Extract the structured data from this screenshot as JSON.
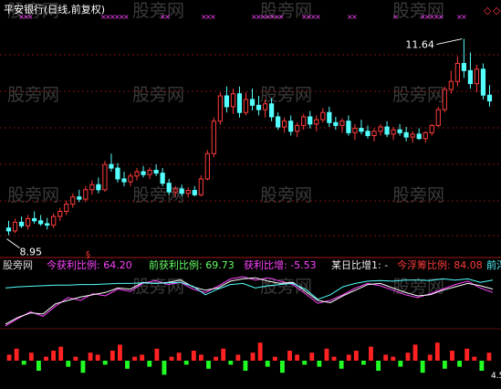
{
  "chart_data": [
    {
      "type": "candlestick",
      "title": "平安银行(日线,前复权)",
      "annotations": {
        "high_label": "11.64",
        "low_label": "8.95"
      },
      "colors": {
        "up": "#ff3b3b",
        "down": "#54ffff",
        "title": "#ffffff",
        "marker": "#ff44ff",
        "grid": "#7a1010"
      },
      "ylim": [
        8.7,
        11.9
      ],
      "candles": [
        [
          9.02,
          9.12,
          8.92,
          8.98
        ],
        [
          8.98,
          9.15,
          8.95,
          9.1
        ],
        [
          9.1,
          9.18,
          9.02,
          9.05
        ],
        [
          9.05,
          9.2,
          9.0,
          9.15
        ],
        [
          9.15,
          9.25,
          9.08,
          9.12
        ],
        [
          9.12,
          9.2,
          9.05,
          9.08
        ],
        [
          9.08,
          9.16,
          9.0,
          9.06
        ],
        [
          9.06,
          9.22,
          9.02,
          9.18
        ],
        [
          9.18,
          9.3,
          9.12,
          9.25
        ],
        [
          9.25,
          9.4,
          9.2,
          9.35
        ],
        [
          9.35,
          9.5,
          9.3,
          9.45
        ],
        [
          9.45,
          9.55,
          9.38,
          9.42
        ],
        [
          9.42,
          9.6,
          9.38,
          9.55
        ],
        [
          9.55,
          9.68,
          9.48,
          9.62
        ],
        [
          9.62,
          9.72,
          9.5,
          9.55
        ],
        [
          9.55,
          9.95,
          9.52,
          9.9
        ],
        [
          9.9,
          10.05,
          9.8,
          9.85
        ],
        [
          9.85,
          9.92,
          9.65,
          9.7
        ],
        [
          9.7,
          9.8,
          9.6,
          9.66
        ],
        [
          9.66,
          9.78,
          9.6,
          9.74
        ],
        [
          9.74,
          9.85,
          9.68,
          9.8
        ],
        [
          9.8,
          9.88,
          9.72,
          9.76
        ],
        [
          9.76,
          9.86,
          9.7,
          9.82
        ],
        [
          9.82,
          9.9,
          9.74,
          9.78
        ],
        [
          9.78,
          9.85,
          9.6,
          9.64
        ],
        [
          9.64,
          9.7,
          9.48,
          9.52
        ],
        [
          9.52,
          9.6,
          9.45,
          9.56
        ],
        [
          9.56,
          9.62,
          9.46,
          9.5
        ],
        [
          9.5,
          9.58,
          9.44,
          9.54
        ],
        [
          9.54,
          9.6,
          9.46,
          9.48
        ],
        [
          9.48,
          9.75,
          9.46,
          9.7
        ],
        [
          9.7,
          10.1,
          9.68,
          10.05
        ],
        [
          10.05,
          10.55,
          10.0,
          10.5
        ],
        [
          10.5,
          10.9,
          10.45,
          10.85
        ],
        [
          10.85,
          10.98,
          10.62,
          10.7
        ],
        [
          10.7,
          10.95,
          10.6,
          10.88
        ],
        [
          10.88,
          10.98,
          10.55,
          10.62
        ],
        [
          10.62,
          10.9,
          10.58,
          10.8
        ],
        [
          10.8,
          10.95,
          10.65,
          10.72
        ],
        [
          10.72,
          10.85,
          10.58,
          10.66
        ],
        [
          10.66,
          10.8,
          10.55,
          10.74
        ],
        [
          10.74,
          10.82,
          10.5,
          10.56
        ],
        [
          10.56,
          10.62,
          10.38,
          10.42
        ],
        [
          10.42,
          10.55,
          10.34,
          10.5
        ],
        [
          10.5,
          10.58,
          10.3,
          10.36
        ],
        [
          10.36,
          10.48,
          10.28,
          10.44
        ],
        [
          10.44,
          10.6,
          10.38,
          10.56
        ],
        [
          10.56,
          10.64,
          10.4,
          10.46
        ],
        [
          10.46,
          10.58,
          10.36,
          10.52
        ],
        [
          10.52,
          10.68,
          10.48,
          10.62
        ],
        [
          10.62,
          10.7,
          10.42,
          10.48
        ],
        [
          10.48,
          10.56,
          10.38,
          10.44
        ],
        [
          10.44,
          10.54,
          10.34,
          10.5
        ],
        [
          10.5,
          10.58,
          10.3,
          10.34
        ],
        [
          10.34,
          10.46,
          10.24,
          10.4
        ],
        [
          10.4,
          10.52,
          10.32,
          10.36
        ],
        [
          10.36,
          10.44,
          10.26,
          10.3
        ],
        [
          10.3,
          10.4,
          10.22,
          10.36
        ],
        [
          10.36,
          10.46,
          10.3,
          10.42
        ],
        [
          10.42,
          10.5,
          10.28,
          10.32
        ],
        [
          10.32,
          10.42,
          10.24,
          10.38
        ],
        [
          10.38,
          10.46,
          10.3,
          10.34
        ],
        [
          10.34,
          10.42,
          10.22,
          10.28
        ],
        [
          10.28,
          10.36,
          10.2,
          10.32
        ],
        [
          10.32,
          10.4,
          10.24,
          10.26
        ],
        [
          10.26,
          10.36,
          10.2,
          10.34
        ],
        [
          10.34,
          10.46,
          10.3,
          10.44
        ],
        [
          10.44,
          10.7,
          10.42,
          10.66
        ],
        [
          10.66,
          10.98,
          10.62,
          10.94
        ],
        [
          10.94,
          11.2,
          10.88,
          11.05
        ],
        [
          11.05,
          11.4,
          10.98,
          11.3
        ],
        [
          11.3,
          11.64,
          11.1,
          11.2
        ],
        [
          11.2,
          11.45,
          10.95,
          11.02
        ],
        [
          11.02,
          11.28,
          10.9,
          11.22
        ],
        [
          11.22,
          11.3,
          10.8,
          10.86
        ],
        [
          10.86,
          11.0,
          10.7,
          10.78
        ]
      ]
    },
    {
      "type": "line",
      "legend": [
        {
          "name": "股旁网",
          "value": "",
          "color": "#d8d8d8"
        },
        {
          "name": "今获利比例:",
          "value": "64.20",
          "color": "#ff44ff"
        },
        {
          "name": "前获利比例:",
          "value": "69.73",
          "color": "#66ff66"
        },
        {
          "name": "获利比增:",
          "value": "-5.53",
          "color": "#ff44ff"
        },
        {
          "name": "某日比增1:",
          "value": "-",
          "color": "#e8e8e8"
        },
        {
          "name": "今浮筹比例:",
          "value": "84.08",
          "color": "#ff3b3b"
        },
        {
          "name": "前浮",
          "value": "",
          "color": "#54ffff"
        }
      ],
      "ylim": [
        0,
        100
      ],
      "series": [
        {
          "name": "今获利比例",
          "color": "#ff44ff",
          "values": [
            5,
            18,
            30,
            22,
            40,
            55,
            50,
            62,
            58,
            70,
            66,
            80,
            85,
            78,
            82,
            70,
            64,
            75,
            88,
            92,
            86,
            90,
            84,
            78,
            62,
            45,
            50,
            60,
            72,
            80,
            76,
            68,
            60,
            55,
            62,
            70,
            78,
            84,
            72,
            64
          ]
        },
        {
          "name": "前获利比例",
          "color": "#ffffff",
          "values": [
            8,
            20,
            28,
            26,
            44,
            50,
            56,
            60,
            64,
            72,
            70,
            82,
            80,
            82,
            86,
            74,
            68,
            72,
            84,
            88,
            90,
            84,
            80,
            82,
            66,
            50,
            46,
            58,
            68,
            78,
            80,
            72,
            64,
            58,
            60,
            68,
            74,
            80,
            76,
            70
          ]
        },
        {
          "name": "今浮筹比例",
          "color": "#54ffff",
          "values": [
            72,
            74,
            75,
            76,
            77,
            77,
            78,
            78,
            79,
            80,
            80,
            81,
            80,
            81,
            82,
            75,
            60,
            70,
            78,
            80,
            72,
            76,
            78,
            80,
            70,
            52,
            60,
            74,
            80,
            84,
            85,
            84,
            86,
            86,
            85,
            88,
            86,
            88,
            82,
            86
          ]
        }
      ]
    },
    {
      "type": "bar",
      "ylim": [
        -1,
        1
      ],
      "colors": {
        "positive": "#ff2222",
        "negative": "#22ff22"
      },
      "values": [
        0.3,
        0.6,
        -0.2,
        0.4,
        -0.5,
        0.2,
        0.5,
        0.7,
        -0.3,
        0.2,
        -0.6,
        0.4,
        0.3,
        -0.2,
        0.5,
        0.8,
        -0.4,
        0.2,
        0.3,
        -0.3,
        0.6,
        -0.7,
        0.2,
        0.4,
        -0.2,
        0.5,
        0.3,
        -0.4,
        0.2,
        0.6,
        -0.2,
        0.3,
        -0.5,
        0.4,
        0.9,
        -0.3,
        0.2,
        -0.6,
        0.5,
        0.3,
        -0.2,
        0.4,
        -0.3,
        0.6,
        0.2,
        -0.4,
        0.3,
        0.5,
        -0.2,
        0.7,
        -0.5,
        0.3,
        0.2,
        -0.3,
        0.4,
        0.8,
        -0.6,
        0.3,
        0.9,
        -0.4,
        0.5,
        -0.3,
        0.6,
        0.2,
        -0.5,
        0.4
      ],
      "tick_label": "4.5"
    }
  ],
  "watermark": "股旁网",
  "marker_symbol": "×"
}
